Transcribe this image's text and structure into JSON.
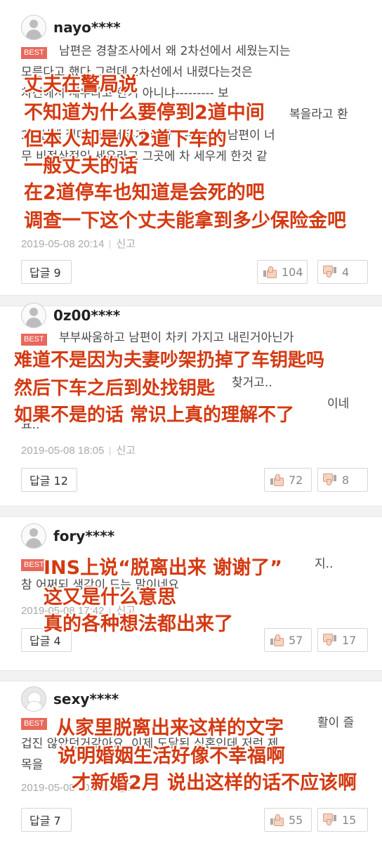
{
  "comments": [
    {
      "username": "nayo****",
      "badge": "BEST",
      "korean_lines": [
        "남편은 경찰조사에서 왜 2차선에서 세웠는지는",
        "모른다고 했다 그런데 2차선에서 내렸다는것은",
        "차선에서 세우라고 한거 아니냐--------- 보",
        "",
        "2차선에 절대 차로세우게 한다 ------------남편이 너",
        "무 비정상적인 세우라고 그곳에 차 세우게 한것 같",
        ""
      ],
      "korean_right_fragment": "복을라고 환",
      "date": "2019-05-08 20:14",
      "report": "신고",
      "reply_label": "답글 9",
      "likes": "104",
      "dislikes": "4",
      "overlay_lines": [
        "丈夫在警局说",
        "不知道为什么要停到2道中间",
        "但本人却是从2道下车的",
        "一般丈夫的话",
        "在2道停车也知道是会死的吧",
        "调查一下这个丈夫能拿到多少保险金吧"
      ]
    },
    {
      "username": "0z00****",
      "badge": "BEST",
      "korean_lines": [
        "부부싸움하고 남편이 차키 가지고 내린거아닌가",
        "",
        "찾거고..",
        "이네",
        "요.."
      ],
      "date": "2019-05-08 18:05",
      "report": "신고",
      "reply_label": "답글 12",
      "likes": "72",
      "dislikes": "8",
      "overlay_lines": [
        "难道不是因为夫妻吵架扔掉了车钥匙吗",
        "然后下车之后到处找钥匙",
        "如果不是的话 常识上真的理解不了"
      ]
    },
    {
      "username": "fory****",
      "badge": "BEST",
      "korean_lines": [
        "지..",
        "참 어쩌되 생각이 드는 말이네요"
      ],
      "date": "2019-05-08 17:42",
      "report": "신고",
      "reply_label": "답글 4",
      "likes": "57",
      "dislikes": "17",
      "overlay_lines": [
        "INS上说“脱离出来 谢谢了”",
        "这又是什么意思",
        "真的各种想法都出来了"
      ]
    },
    {
      "username": "sexy****",
      "badge": "BEST",
      "korean_lines": [
        "활이 즐",
        "겁진 않았던거같아요. 이제 도달된 싱혼인데 저런 제",
        "목을 "
      ],
      "date": "2019-05-08 20:22",
      "report": "신고",
      "reply_label": "답글 7",
      "likes": "55",
      "dislikes": "15",
      "overlay_lines": [
        "从家里脱离出来这样的文字",
        "说明婚姻生活好像不幸福啊",
        "才新婚2月 说出这样的话不应该啊"
      ]
    }
  ],
  "icons": {
    "avatar": "user-avatar-icon",
    "like": "thumbs-up-icon",
    "dislike": "thumbs-down-icon"
  },
  "colors": {
    "best_badge": "#e8685c",
    "overlay_text": "#d43a12"
  }
}
